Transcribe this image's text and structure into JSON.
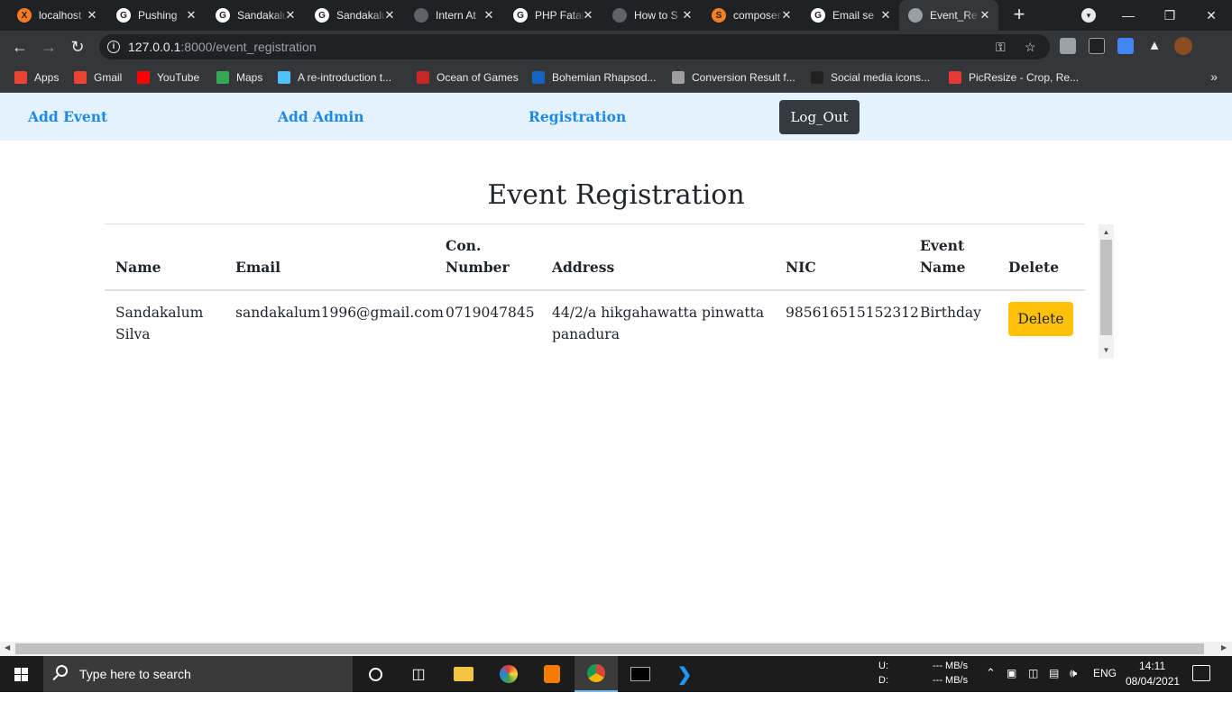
{
  "browser": {
    "tabs": [
      {
        "label": "localhost",
        "icon": "xampp-icon",
        "color": "#fb7a24",
        "glyph": "X"
      },
      {
        "label": "Pushing",
        "icon": "github-icon",
        "color": "#ffffff",
        "glyph": "G"
      },
      {
        "label": "Sandakalum",
        "icon": "github-icon",
        "color": "#ffffff",
        "glyph": "G"
      },
      {
        "label": "Sandakalum",
        "icon": "github-icon",
        "color": "#ffffff",
        "glyph": "G"
      },
      {
        "label": "Intern At",
        "icon": "globe-icon",
        "color": "#5f6368",
        "glyph": ""
      },
      {
        "label": "PHP Fatal",
        "icon": "google-icon",
        "color": "#ffffff",
        "glyph": "G"
      },
      {
        "label": "How to S",
        "icon": "globe-icon",
        "color": "#5f6368",
        "glyph": ""
      },
      {
        "label": "composer",
        "icon": "stackoverflow-icon",
        "color": "#f48024",
        "glyph": "S"
      },
      {
        "label": "Email se",
        "icon": "github-icon",
        "color": "#ffffff",
        "glyph": "G"
      },
      {
        "label": "Event_Re",
        "icon": "globe-icon",
        "color": "#9aa0a6",
        "glyph": "",
        "active": true
      }
    ],
    "url_host": "127.0.0.1",
    "url_rest": ":8000/event_registration",
    "bookmarks": [
      {
        "label": "Apps",
        "color": "#ea4335"
      },
      {
        "label": "Gmail",
        "color": "#ea4335"
      },
      {
        "label": "YouTube",
        "color": "#ff0000"
      },
      {
        "label": "Maps",
        "color": "#34a853"
      },
      {
        "label": "A re-introduction t...",
        "color": "#4fc3f7"
      },
      {
        "label": "Ocean of Games",
        "color": "#c62828"
      },
      {
        "label": "Bohemian Rhapsod...",
        "color": "#1565c0"
      },
      {
        "label": "Conversion Result f...",
        "color": "#9e9e9e"
      },
      {
        "label": "Social media icons...",
        "color": "#212121"
      },
      {
        "label": "PicResize - Crop, Re...",
        "color": "#e53935"
      }
    ],
    "more_glyph": "»"
  },
  "nav": {
    "add_event": "Add Event",
    "add_admin": "Add Admin",
    "registration": "Registration",
    "logout": "Log_Out"
  },
  "page": {
    "title": "Event Registration"
  },
  "table": {
    "headers": {
      "name": "Name",
      "email": "Email",
      "con_1": "Con.",
      "con_2": "Number",
      "address": "Address",
      "nic": "NIC",
      "event_1": "Event",
      "event_2": "Name",
      "delete": "Delete"
    },
    "rows": [
      {
        "name_1": "Sandakalum",
        "name_2": "Silva",
        "email": "sandakalum1996@gmail.com",
        "contact": "0719047845",
        "address_1": "44/2/a hikgahawatta pinwatta",
        "address_2": "panadura",
        "nic": "985616515152312",
        "event": "Birthday",
        "delete_label": "Delete"
      }
    ]
  },
  "taskbar": {
    "search_placeholder": "Type here to search",
    "net_u_label": "U:",
    "net_d_label": "D:",
    "net_u_value": "--- MB/s",
    "net_d_value": "--- MB/s",
    "lang": "ENG",
    "time": "14:11",
    "date": "08/04/2021"
  },
  "colors": {
    "nav_bg": "#e3f2fd",
    "nav_link": "#1e88e5",
    "logout_bg": "#343a40",
    "delete_bg": "#ffc107"
  }
}
